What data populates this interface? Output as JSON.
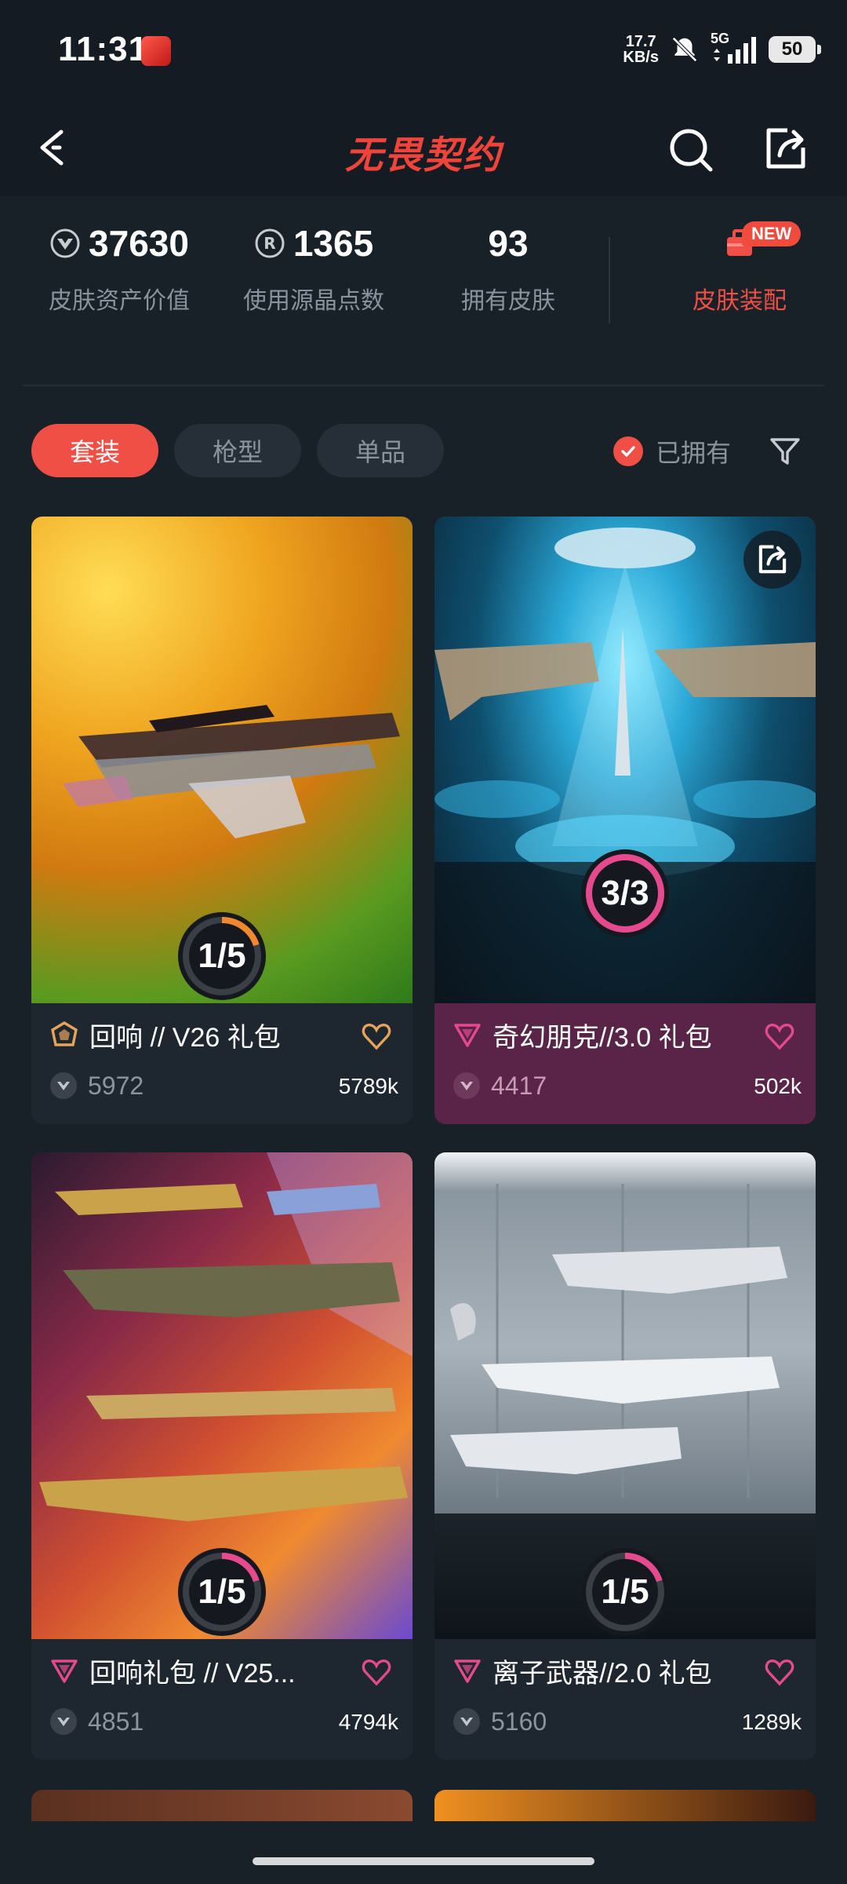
{
  "status_bar": {
    "time": "11:31",
    "net_speed_value": "17.7",
    "net_speed_unit": "KB/s",
    "network": "5G",
    "battery": "50"
  },
  "header": {
    "title": "无畏契约"
  },
  "stats": [
    {
      "value": "37630",
      "label": "皮肤资产价值"
    },
    {
      "value": "1365",
      "label": "使用源晶点数"
    },
    {
      "value": "93",
      "label": "拥有皮肤"
    }
  ],
  "equip": {
    "label": "皮肤装配",
    "badge": "NEW"
  },
  "filters": {
    "tabs": [
      "套装",
      "枪型",
      "单品"
    ],
    "owned_label": "已拥有"
  },
  "cards": [
    {
      "title": "回响 // V26 礼包",
      "price": "5972",
      "likes": "5789k",
      "progress": "1/5",
      "progress_fraction": 0.2,
      "tier_color": "#e6a35a",
      "heart_color": "#e6a35a"
    },
    {
      "title": "奇幻朋克//3.0 礼包",
      "price": "4417",
      "likes": "502k",
      "progress": "3/3",
      "progress_fraction": 1.0,
      "tier_color": "#e64a8e",
      "heart_color": "#e64a8e"
    },
    {
      "title": "回响礼包 // V25...",
      "price": "4851",
      "likes": "4794k",
      "progress": "1/5",
      "progress_fraction": 0.2,
      "tier_color": "#e64a8e",
      "heart_color": "#e64a8e"
    },
    {
      "title": "离子武器//2.0 礼包",
      "price": "5160",
      "likes": "1289k",
      "progress": "1/5",
      "progress_fraction": 0.2,
      "tier_color": "#e64a8e",
      "heart_color": "#e64a8e"
    }
  ],
  "colors": {
    "accent": "#f04f46",
    "background": "#182028",
    "card": "#1e272f",
    "card_highlight": "#5a2448"
  }
}
